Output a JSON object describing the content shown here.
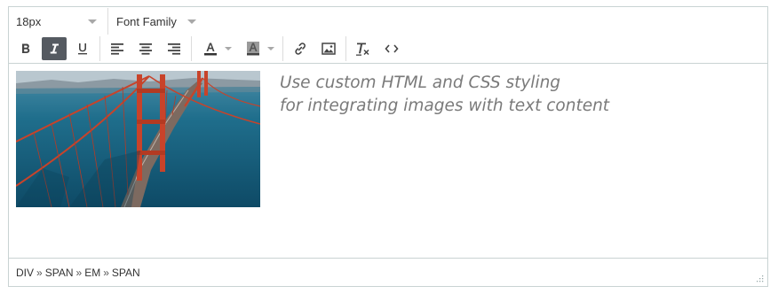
{
  "toolbar": {
    "font_size": {
      "value": "18px",
      "icon": "chevron-down-icon"
    },
    "font_family": {
      "value": "Font Family",
      "icon": "chevron-down-icon"
    },
    "buttons": [
      {
        "name": "bold",
        "icon": "bold-icon",
        "active": false
      },
      {
        "name": "italic",
        "icon": "italic-icon",
        "active": true
      },
      {
        "name": "underline",
        "icon": "underline-icon",
        "active": false
      },
      {
        "name": "align-left",
        "icon": "align-left-icon"
      },
      {
        "name": "align-center",
        "icon": "align-center-icon"
      },
      {
        "name": "align-right",
        "icon": "align-right-icon"
      },
      {
        "name": "text-color",
        "icon": "text-color-icon"
      },
      {
        "name": "background-color",
        "icon": "background-color-icon"
      },
      {
        "name": "insert-link",
        "icon": "link-icon"
      },
      {
        "name": "insert-image",
        "icon": "image-icon"
      },
      {
        "name": "clear-formatting",
        "icon": "clear-formatting-icon"
      },
      {
        "name": "source-code",
        "icon": "code-icon"
      }
    ]
  },
  "content": {
    "image": {
      "subject": "golden-gate-bridge-photo"
    },
    "text_lines": [
      "Use custom HTML and CSS styling",
      "for integrating images with text content"
    ],
    "text_color": "#7a7a7a"
  },
  "status_bar": {
    "path": [
      "DIV",
      "SPAN",
      "EM",
      "SPAN"
    ],
    "separator": "»"
  },
  "colors": {
    "border": "#c9d3d3",
    "active_button": "#555a61",
    "icon": "#444444"
  }
}
